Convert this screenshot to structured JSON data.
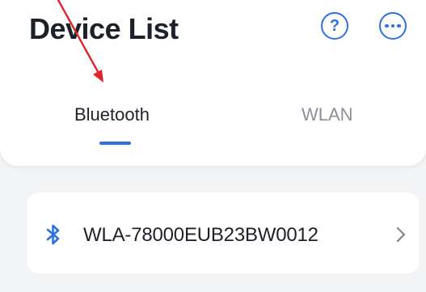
{
  "header": {
    "title": "Device List",
    "help_icon": "question-circle-icon",
    "more_icon": "more-dots-icon"
  },
  "tabs": [
    {
      "label": "Bluetooth",
      "active": true
    },
    {
      "label": "WLAN",
      "active": false
    }
  ],
  "devices": [
    {
      "name": "WLA-78000EUB23BW0012",
      "icon": "bluetooth-icon",
      "trailing_icon": "chevron-right-icon"
    }
  ],
  "colors": {
    "accent": "#2f6fe4",
    "text_primary": "#1d2129",
    "text_secondary": "#8a8f99",
    "background": "#f2f4f6",
    "annotation_arrow": "#e0252a"
  }
}
